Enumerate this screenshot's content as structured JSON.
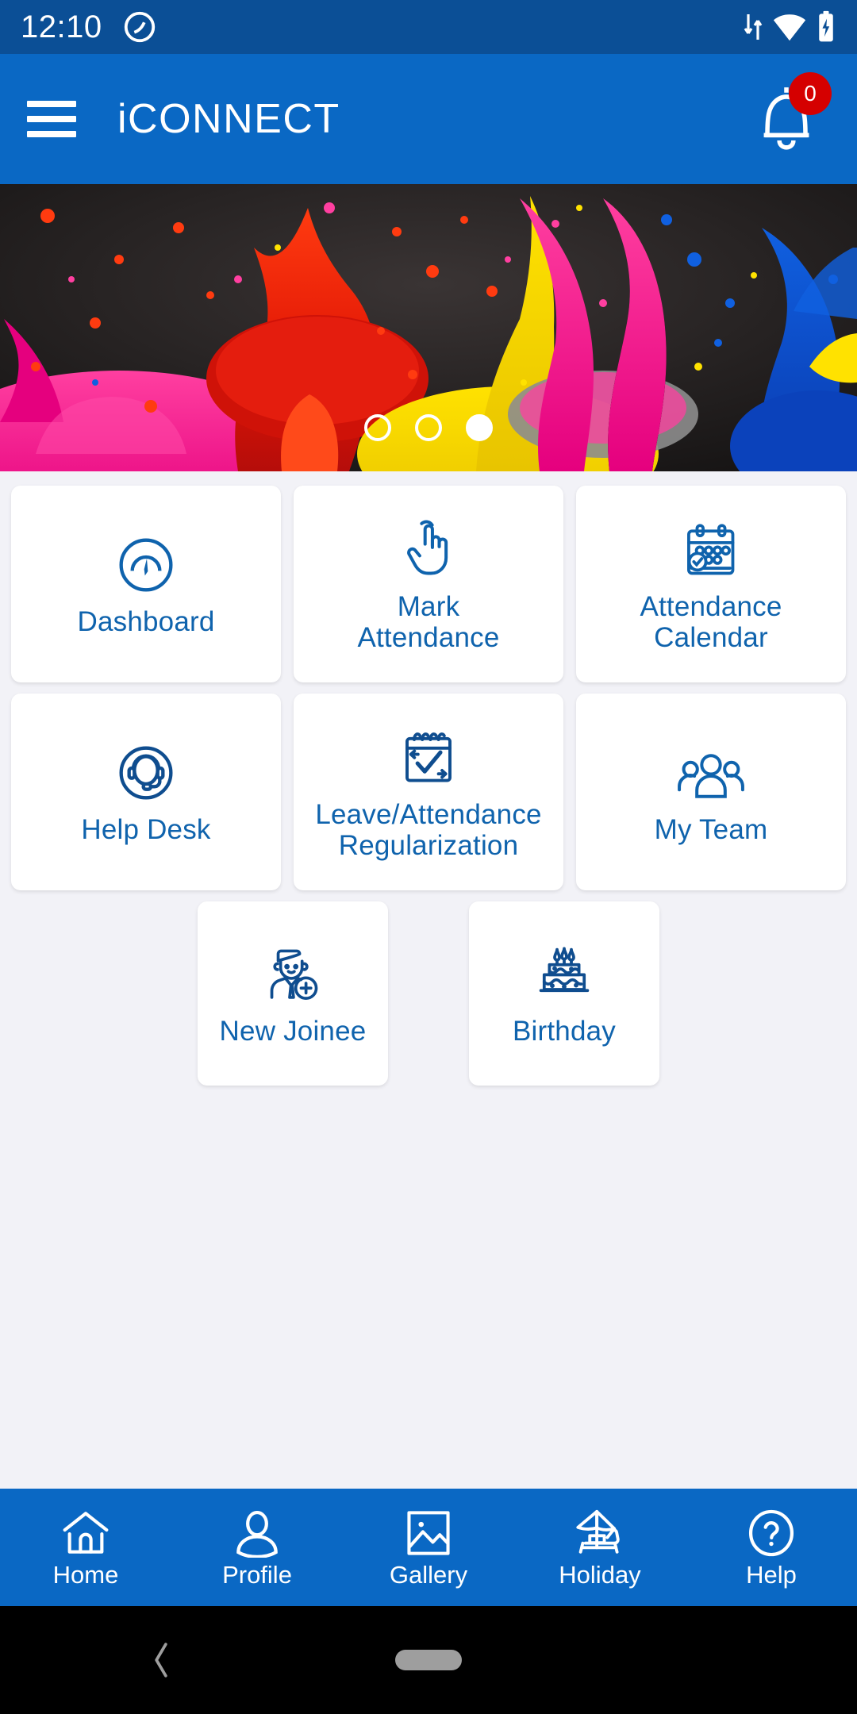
{
  "statusbar": {
    "time": "12:10",
    "app_icon": "circle-slash-icon",
    "icons": [
      "data-transfer-icon",
      "wifi-icon",
      "battery-charging-icon"
    ]
  },
  "appbar": {
    "menu_icon": "hamburger-menu-icon",
    "title": "iCONNECT",
    "notification_icon": "bell-icon",
    "notification_count": "0",
    "badge_color": "#d50000",
    "background_color": "#0a68c4"
  },
  "hero": {
    "description": "paint-splash-banner",
    "carousel": {
      "total": 3,
      "active_index": 2
    }
  },
  "grid": {
    "rows": [
      [
        {
          "label": "Dashboard",
          "icon": "speedometer-icon"
        },
        {
          "label": "Mark\nAttendance",
          "icon": "tap-hand-icon"
        },
        {
          "label": "Attendance\nCalendar",
          "icon": "calendar-check-icon"
        }
      ],
      [
        {
          "label": "Help Desk",
          "icon": "headset-support-icon"
        },
        {
          "label": "Leave/Attendance\nRegularization",
          "icon": "calendar-approve-icon"
        },
        {
          "label": "My Team",
          "icon": "people-group-icon"
        }
      ],
      [
        {
          "label": "New Joinee",
          "icon": "new-employee-icon"
        },
        {
          "label": "Birthday",
          "icon": "birthday-cake-icon"
        }
      ]
    ],
    "label_color": "#0f63ad",
    "card_background": "#ffffff",
    "page_background": "#f2f2f7"
  },
  "bottomnav": {
    "items": [
      {
        "label": "Home",
        "icon": "home-icon"
      },
      {
        "label": "Profile",
        "icon": "person-icon"
      },
      {
        "label": "Gallery",
        "icon": "image-icon"
      },
      {
        "label": "Holiday",
        "icon": "beach-umbrella-icon"
      },
      {
        "label": "Help",
        "icon": "question-circle-icon"
      }
    ],
    "background_color": "#0a68c4"
  },
  "androidnav": {
    "back_icon": "back-chevron-icon",
    "home_pill": "home-pill-indicator"
  }
}
